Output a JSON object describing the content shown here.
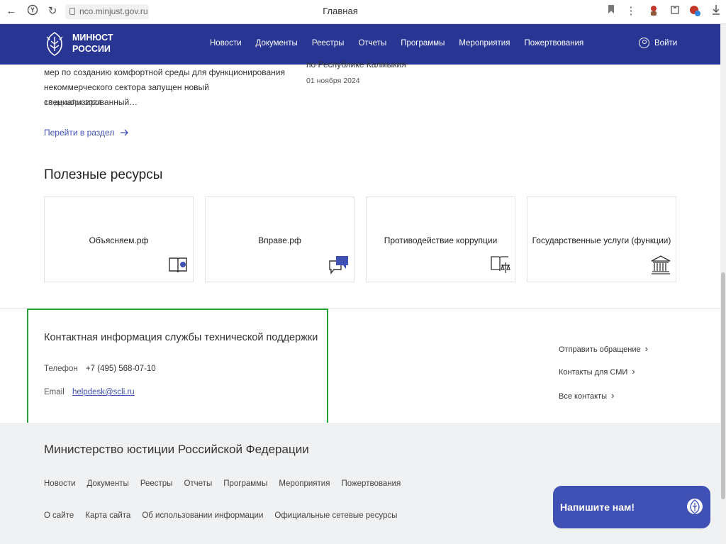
{
  "browser": {
    "url": "nco.minjust.gov.ru",
    "tab_title": "Главная"
  },
  "header": {
    "logo_line1": "МИНЮСТ",
    "logo_line2": "РОССИИ",
    "nav": [
      "Новости",
      "Документы",
      "Реестры",
      "Отчеты",
      "Программы",
      "Мероприятия",
      "Пожертвования"
    ],
    "login": "Войти"
  },
  "news": {
    "item1_line1": "мер по созданию комфортной среды для функционирования",
    "item1_line2": "некоммерческого сектора запущен новый специализированный…",
    "item1_date": "13 декабря 2024",
    "item2_title": "по Республике Калмыкия",
    "item2_date": "01 ноября 2024",
    "goto": "Перейти в раздел"
  },
  "resources": {
    "title": "Полезные ресурсы",
    "cards": [
      "Объясняем.рф",
      "Вправе.рф",
      "Противодействие коррупции",
      "Государственные услуги (функции)"
    ]
  },
  "contact": {
    "title": "Контактная информация службы технической поддержки",
    "phone_label": "Телефон",
    "phone": "+7 (495) 568-07-10",
    "email_label": "Email",
    "email": "helpdesk@scli.ru",
    "links": [
      "Отправить обращение",
      "Контакты для СМИ",
      "Все контакты"
    ]
  },
  "footer": {
    "title": "Министерство юстиции Российской Федерации",
    "nav1": [
      "Новости",
      "Документы",
      "Реестры",
      "Отчеты",
      "Программы",
      "Мероприятия",
      "Пожертвования"
    ],
    "nav2": [
      "О сайте",
      "Карта сайта",
      "Об использовании информации",
      "Официальные сетевые ресурсы"
    ]
  },
  "chat": {
    "label": "Напишите нам!"
  },
  "colors": {
    "brand": "#283593",
    "accent": "#3f51b5",
    "highlight": "#21a038"
  }
}
